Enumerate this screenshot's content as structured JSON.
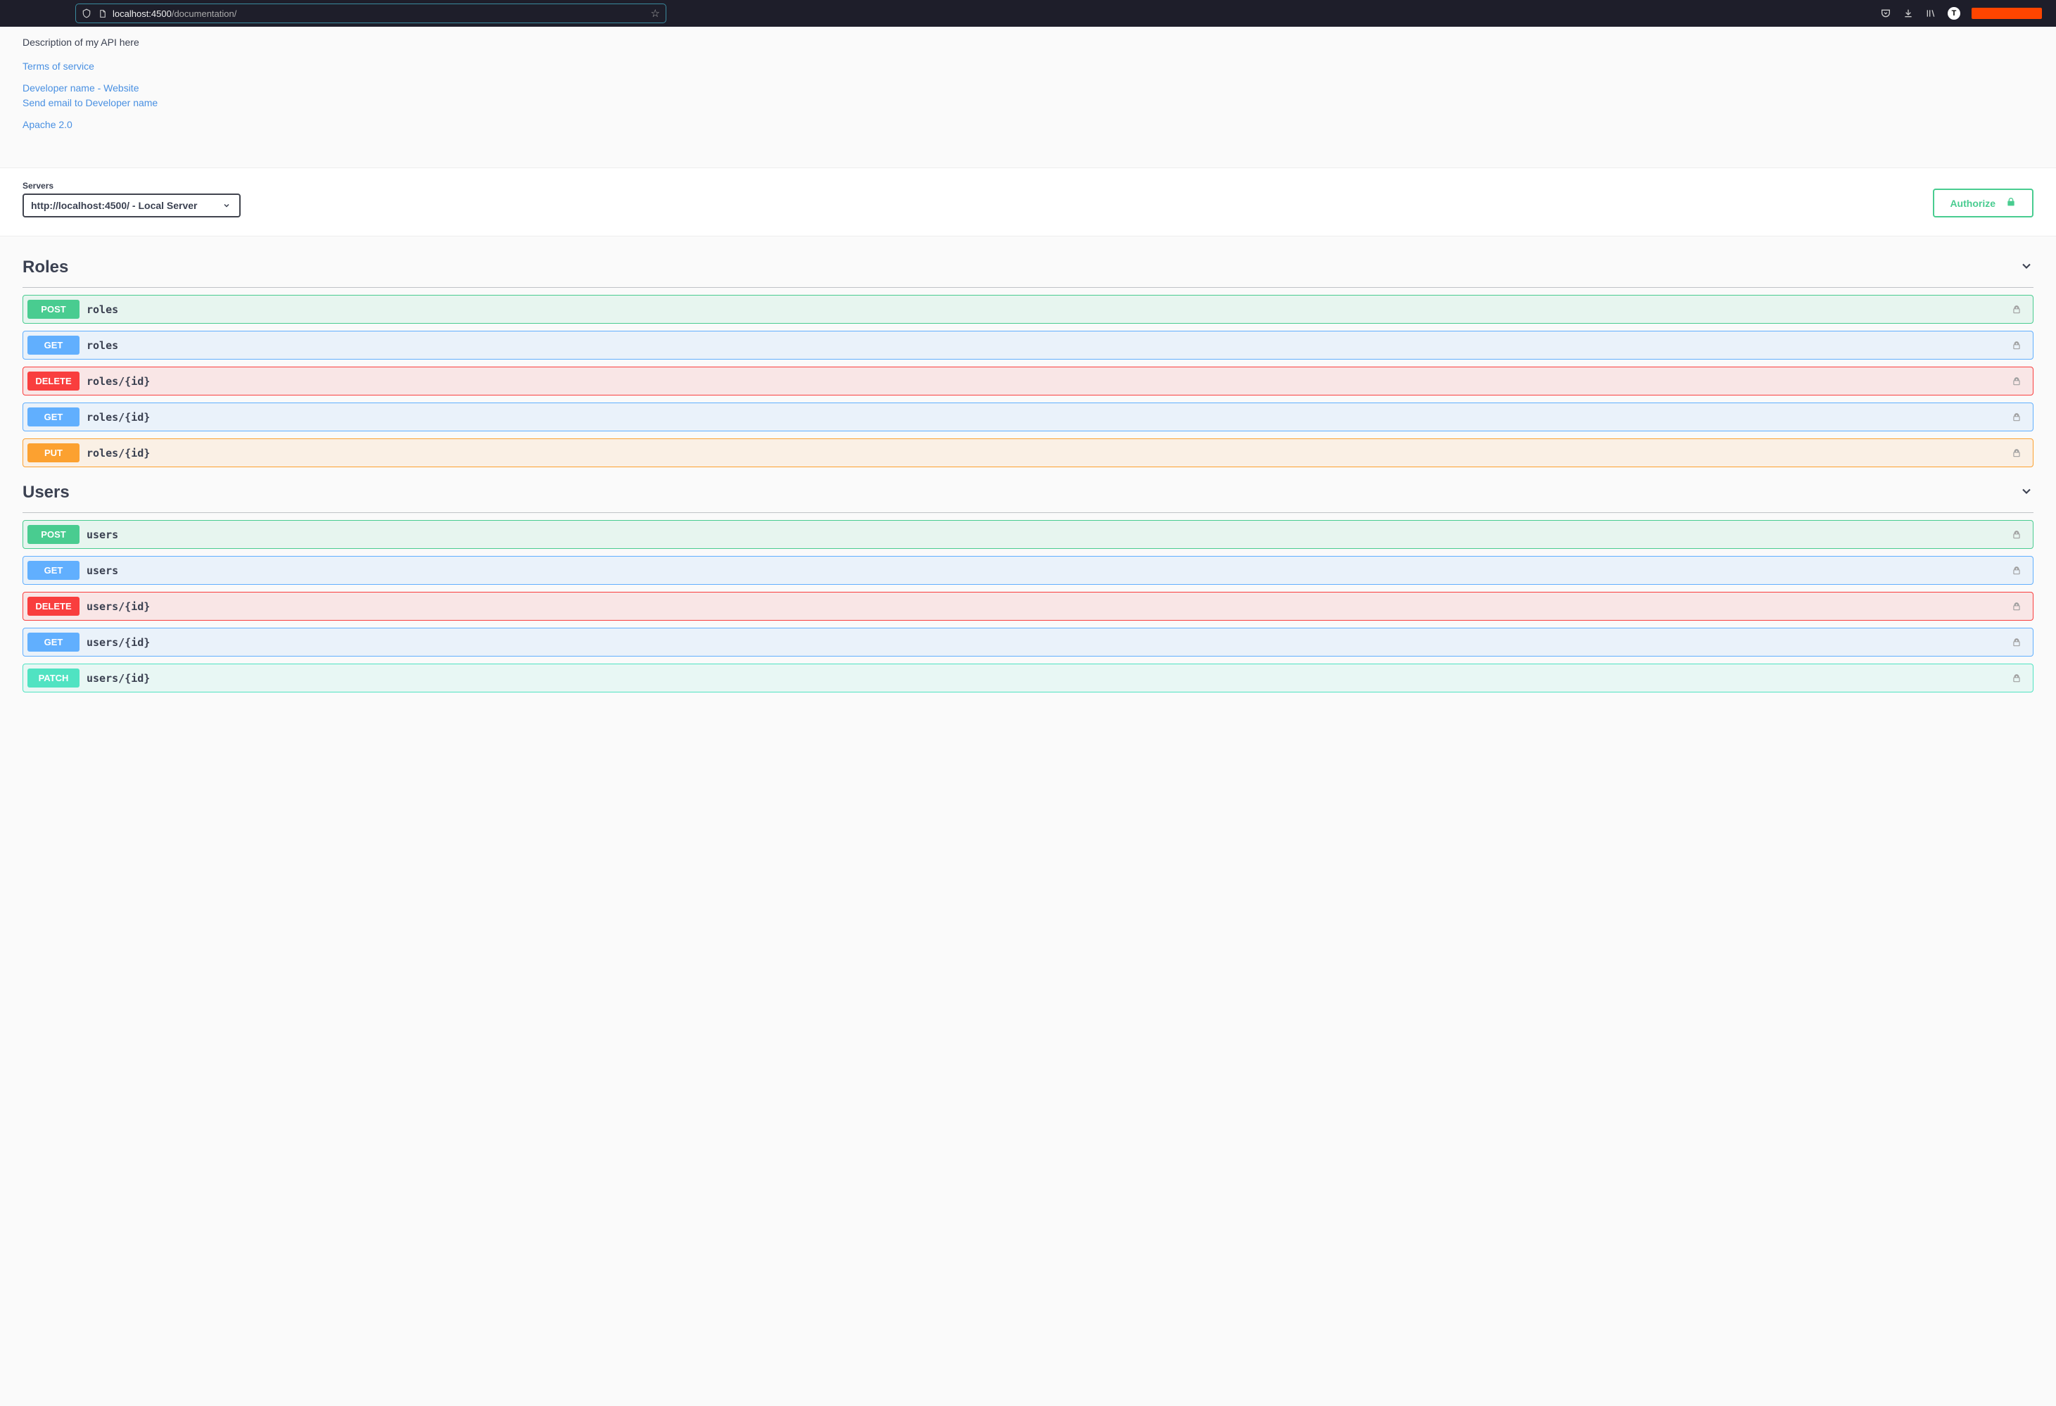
{
  "browser": {
    "url_host": "localhost:4500",
    "url_path": "/documentation/",
    "profile_letter": "T"
  },
  "info": {
    "description": "Description of my API here",
    "terms": "Terms of service",
    "contact_site": "Developer name - Website",
    "contact_email": "Send email to Developer name",
    "license": "Apache 2.0"
  },
  "servers": {
    "label": "Servers",
    "selected": "http://localhost:4500/ - Local Server"
  },
  "authorize": {
    "label": "Authorize"
  },
  "tags": [
    {
      "name": "Roles",
      "operations": [
        {
          "method": "POST",
          "path": "roles"
        },
        {
          "method": "GET",
          "path": "roles"
        },
        {
          "method": "DELETE",
          "path": "roles/{id}"
        },
        {
          "method": "GET",
          "path": "roles/{id}"
        },
        {
          "method": "PUT",
          "path": "roles/{id}"
        }
      ]
    },
    {
      "name": "Users",
      "operations": [
        {
          "method": "POST",
          "path": "users"
        },
        {
          "method": "GET",
          "path": "users"
        },
        {
          "method": "DELETE",
          "path": "users/{id}"
        },
        {
          "method": "GET",
          "path": "users/{id}"
        },
        {
          "method": "PATCH",
          "path": "users/{id}"
        }
      ]
    }
  ]
}
